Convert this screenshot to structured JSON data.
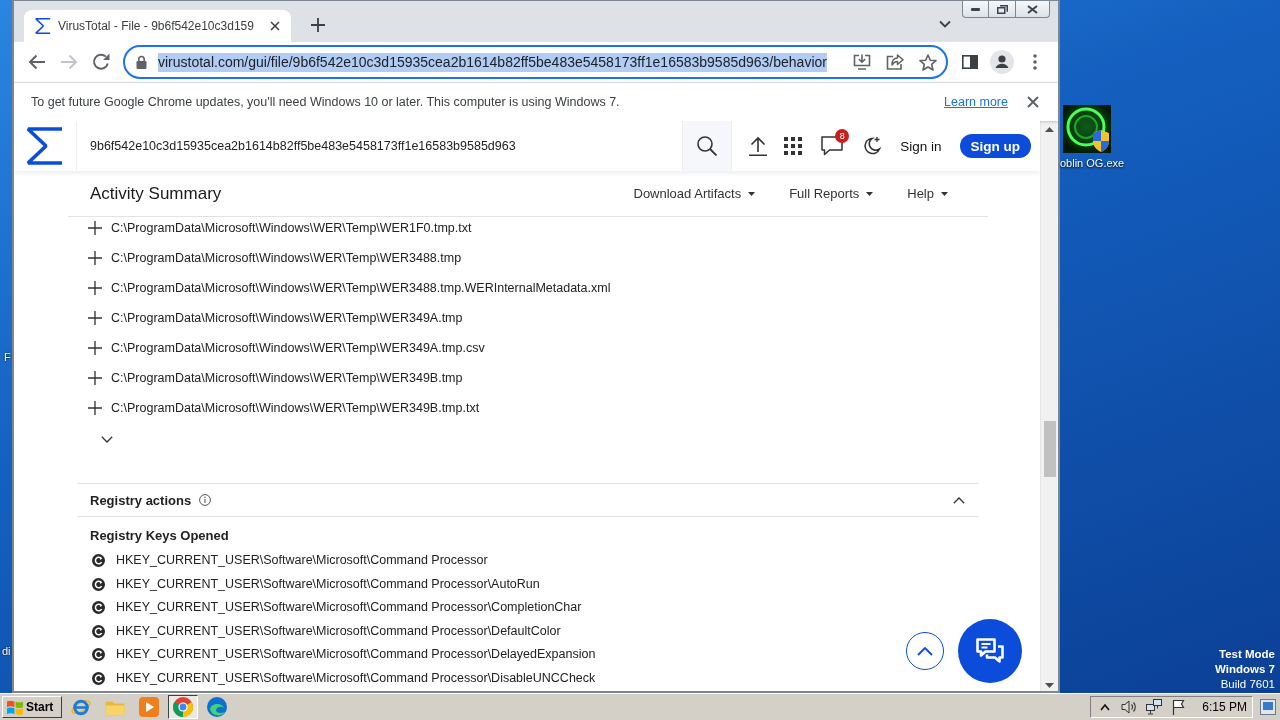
{
  "desktop": {
    "left_labels": [
      "F",
      "di"
    ],
    "icons": [
      {
        "label": "oblin OG.exe"
      }
    ],
    "notice": {
      "mode": "Test Mode",
      "os": "Windows 7",
      "build": "Build 7601"
    }
  },
  "browser": {
    "tabs": [
      {
        "title": "VirusTotal - File - 9b6f542e10c3d159",
        "selected": true
      }
    ],
    "navigation": [
      {
        "kind": "back",
        "disabled": false
      },
      {
        "kind": "forward",
        "disabled": true
      },
      {
        "kind": "reload",
        "disabled": false
      }
    ],
    "address_bar": {
      "url": "virustotal.com/gui/file/9b6f542e10c3d15935cea2b1614b82ff5be483e5458173ff1e16583b9585d963/behavior",
      "focused": true,
      "text_selected": true
    },
    "infobar": {
      "message": "To get future Google Chrome updates, you'll need Windows 10 or later. This computer is using Windows 7.",
      "link": "Learn more"
    }
  },
  "site_header": {
    "search_value": "9b6f542e10c3d15935cea2b1614b82ff5be483e5458173ff1e16583b9585d963",
    "notification_count": "8",
    "sign_in": "Sign in",
    "sign_up": "Sign up"
  },
  "activity_bar": {
    "title": "Activity Summary",
    "menus": [
      "Download Artifacts",
      "Full Reports",
      "Help"
    ]
  },
  "files": [
    "C:\\ProgramData\\Microsoft\\Windows\\WER\\Temp\\WER1F0.tmp.txt",
    "C:\\ProgramData\\Microsoft\\Windows\\WER\\Temp\\WER3488.tmp",
    "C:\\ProgramData\\Microsoft\\Windows\\WER\\Temp\\WER3488.tmp.WERInternalMetadata.xml",
    "C:\\ProgramData\\Microsoft\\Windows\\WER\\Temp\\WER349A.tmp",
    "C:\\ProgramData\\Microsoft\\Windows\\WER\\Temp\\WER349A.tmp.csv",
    "C:\\ProgramData\\Microsoft\\Windows\\WER\\Temp\\WER349B.tmp",
    "C:\\ProgramData\\Microsoft\\Windows\\WER\\Temp\\WER349B.tmp.txt"
  ],
  "registry": {
    "title": "Registry actions",
    "expanded": true,
    "subtitle": "Registry Keys Opened",
    "keys": [
      "HKEY_CURRENT_USER\\Software\\Microsoft\\Command Processor",
      "HKEY_CURRENT_USER\\Software\\Microsoft\\Command Processor\\AutoRun",
      "HKEY_CURRENT_USER\\Software\\Microsoft\\Command Processor\\CompletionChar",
      "HKEY_CURRENT_USER\\Software\\Microsoft\\Command Processor\\DefaultColor",
      "HKEY_CURRENT_USER\\Software\\Microsoft\\Command Processor\\DelayedExpansion",
      "HKEY_CURRENT_USER\\Software\\Microsoft\\Command Processor\\DisableUNCCheck"
    ]
  },
  "taskbar": {
    "start": "Start",
    "apps": [
      {
        "kind": "ie",
        "selected": false
      },
      {
        "kind": "explorer",
        "selected": false
      },
      {
        "kind": "media",
        "selected": false
      },
      {
        "kind": "chrome",
        "selected": true
      },
      {
        "kind": "edge",
        "selected": false
      }
    ],
    "clock": "6:15 PM"
  }
}
